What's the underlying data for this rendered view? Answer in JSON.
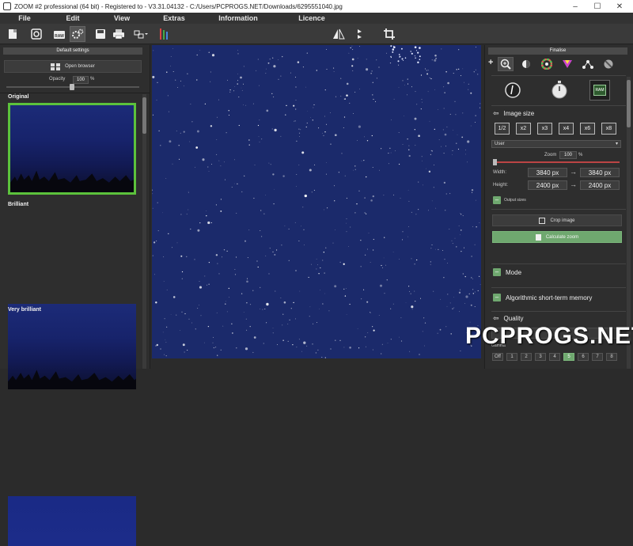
{
  "window": {
    "title": "ZOOM #2 professional (64 bit) - Registered to - V3.31.04132 - C:/Users/PCPROGS.NET/Downloads/6295551040.jpg",
    "controls": [
      "–",
      "☐",
      "✕"
    ]
  },
  "menu": [
    "File",
    "Edit",
    "View",
    "Extras",
    "Information",
    "Licence"
  ],
  "toolbar": {
    "left_icons": [
      "new-file-icon",
      "open-image-icon",
      "raw-icon",
      "batch-process-icon",
      "save-icon",
      "print-icon",
      "export-icon",
      "tools-icon"
    ],
    "raw_label": "RAW",
    "center_icons": [
      "flip-horizontal-icon",
      "flip-vertical-icon",
      "crop-rotate-icon"
    ]
  },
  "left_panel": {
    "header": "Default settings",
    "open_browser": "Open browser",
    "opacity_label": "Opacity",
    "opacity_value": "100",
    "opacity_unit": "%",
    "thumbnails": [
      {
        "label": "Original",
        "selected": true
      },
      {
        "label": "Brilliant",
        "selected": false
      },
      {
        "label": "Very brilliant",
        "selected": false
      }
    ]
  },
  "right_panel": {
    "header": "Finalise",
    "add_symbol": "+",
    "tool_icons": [
      "zoom-icon",
      "contrast-icon",
      "color-wheel-icon",
      "prism-icon",
      "share-icon",
      "no-entry-icon"
    ],
    "mode_icons": [
      "compass-icon",
      "stopwatch-icon",
      "ram-icon"
    ],
    "ram_label": "RAM",
    "image_size": {
      "title": "Image size",
      "scales": [
        "1/2",
        "x2",
        "x3",
        "x4",
        "x6",
        "x8"
      ],
      "preset": "User",
      "zoom_label": "Zoom",
      "zoom_value": "100",
      "zoom_unit": "%",
      "width_label": "Width:",
      "height_label": "Height:",
      "width_from": "3840 px",
      "width_to": "3840 px",
      "height_from": "2400 px",
      "height_to": "2400 px",
      "arrow": "→",
      "output_sizes": "Output sizes",
      "crop_image": "Crop image",
      "calculate_zoom": "Calculate zoom"
    },
    "sections": [
      "Mode",
      "Algorithmic short-term memory",
      "Quality"
    ],
    "quality_prefix": "Gamma",
    "quality_cells": [
      "Off",
      "1",
      "2",
      "3",
      "4",
      "5",
      "6",
      "7",
      "8"
    ],
    "quality_selected": 5
  },
  "watermark": "PCPROGS.NET",
  "colors": {
    "accent_green": "#6fa86f",
    "selected_border": "#5cc23c",
    "sky": "#1b2a6b"
  }
}
